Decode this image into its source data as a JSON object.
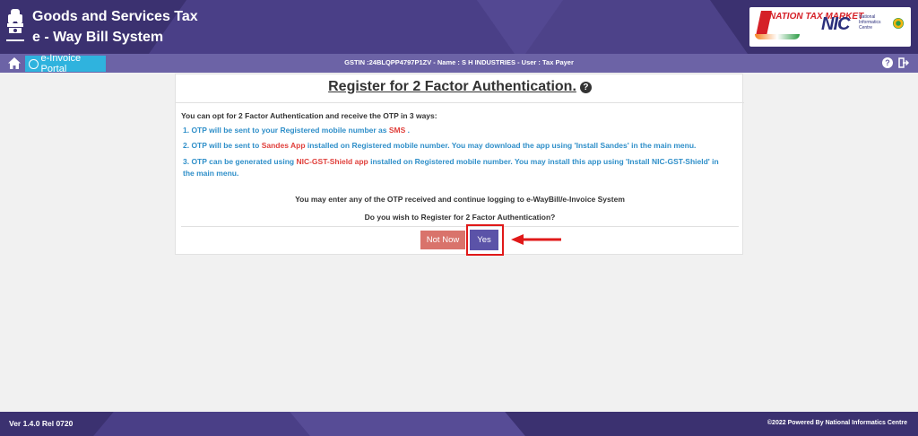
{
  "header": {
    "title_line1": "Goods and Services Tax",
    "title_line2": "e - Way Bill System",
    "ntm_text": "NATION TAX MARKET",
    "nic_logo": "NIC",
    "nic_caption": "National Informatics Centre"
  },
  "navbar": {
    "portal_label": "e-Invoice Portal",
    "user_info": "GSTIN :24BLQPP4797P1ZV - Name : S H INDUSTRIES - User : Tax Payer",
    "help_glyph": "?"
  },
  "card": {
    "title": "Register for 2 Factor Authentication.",
    "help_glyph": "?",
    "intro": "You can opt for 2 Factor Authentication and receive the OTP in 3 ways:",
    "steps": [
      {
        "prefix": "1. OTP will be sent to your Registered mobile number as ",
        "highlight": "SMS",
        "suffix": " ."
      },
      {
        "prefix": "2. OTP will be sent to ",
        "highlight": "Sandes App",
        "suffix": " installed on Registered mobile number. You may download the app using 'Install Sandes' in the main menu."
      },
      {
        "prefix": "3. OTP can be generated using ",
        "highlight": "NIC-GST-Shield app",
        "suffix": " installed on Registered mobile number. You may install this app using 'Install NIC-GST-Shield' in the main menu."
      }
    ],
    "note": "You may enter any of the OTP received and continue logging to e-WayBill/e-Invoice System",
    "question": "Do you wish to Register for 2 Factor Authentication?",
    "not_now_label": "Not Now",
    "yes_label": "Yes"
  },
  "footer": {
    "version": "Ver 1.4.0 Rel 0720",
    "powered_by": "©2022 Powered By National Informatics Centre"
  },
  "icons": {
    "home": "home-icon",
    "globe": "globe-icon",
    "help": "help-icon",
    "logout": "logout-icon",
    "arrow": "red-arrow-icon"
  },
  "colors": {
    "header_bg": "#3b3170",
    "navbar_bg": "#6c63a6",
    "portal_btn": "#2fb3de",
    "step_text": "#2f8fc9",
    "highlight_text": "#e0403c",
    "not_now_btn": "#d9736b",
    "yes_btn": "#5b53a8",
    "annotation_red": "#e01919"
  }
}
